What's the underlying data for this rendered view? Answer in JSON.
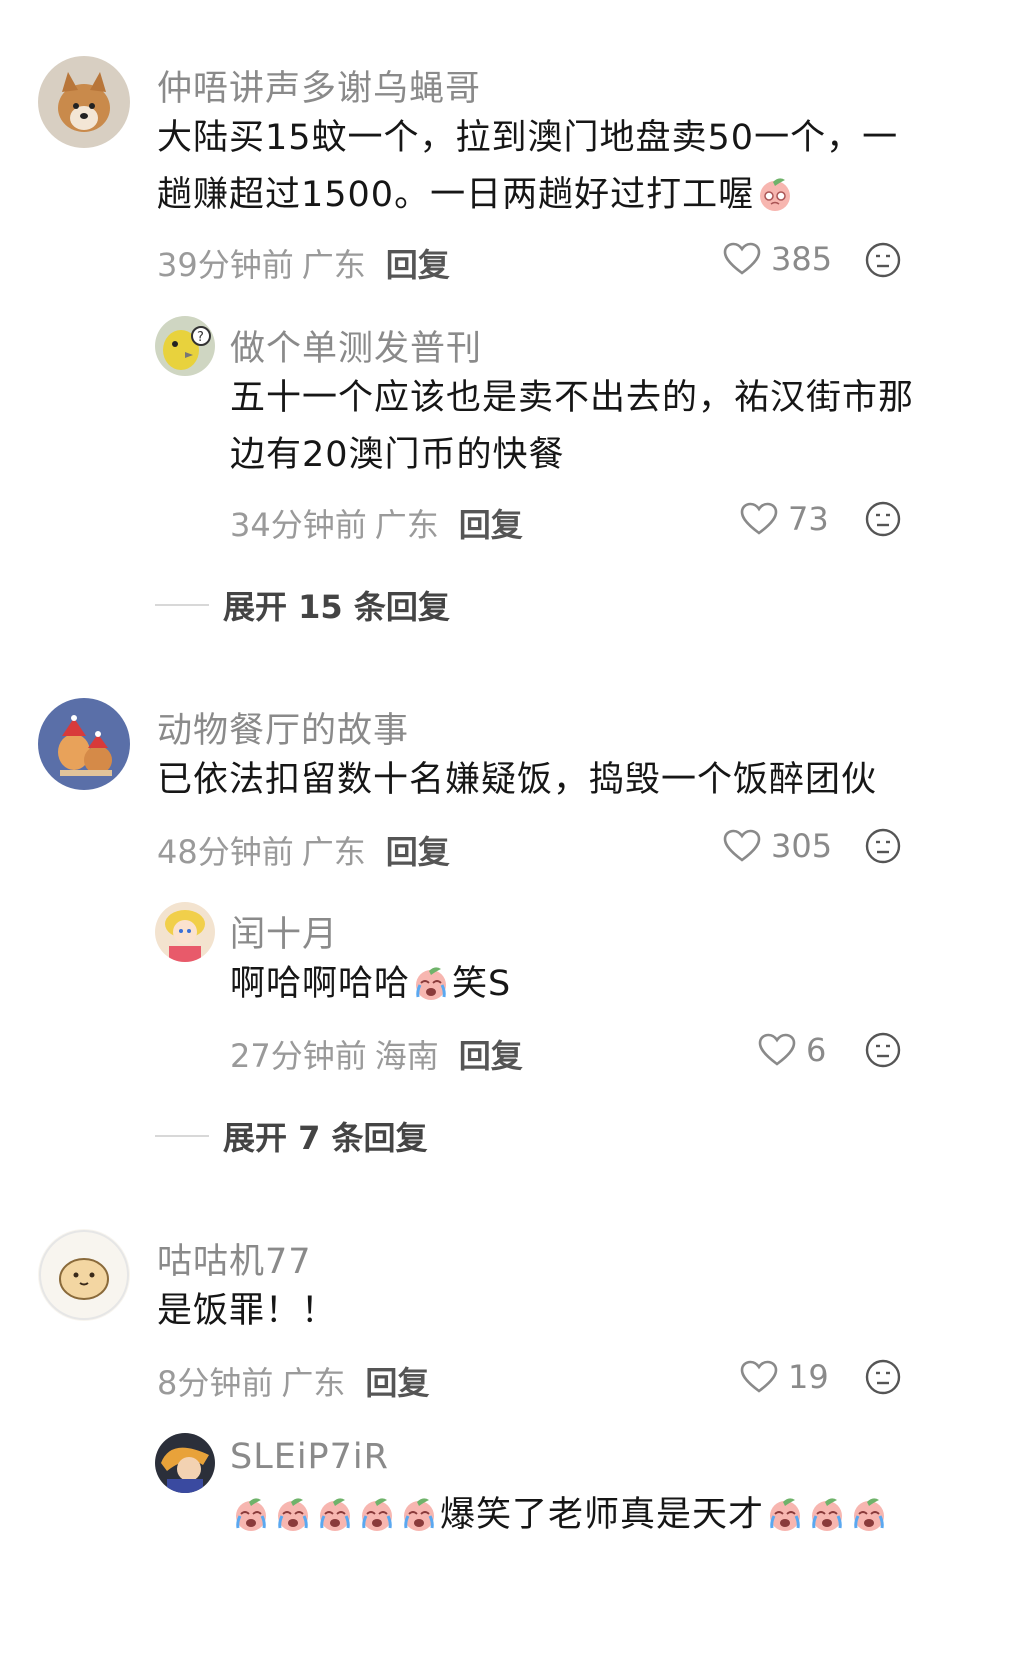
{
  "comments": [
    {
      "name": "仲唔讲声多谢乌蝇哥",
      "text": "大陆买15蚊一个，拉到澳门地盘卖50一个，一趟赚超过1500。一日两趟好过打工喔",
      "time": "39分钟前",
      "location": "广东",
      "reply_label": "回复",
      "likes": "385",
      "avatar": "shiba-dog-photo"
    },
    {
      "name": "做个单测发普刊",
      "text": "五十一个应该也是卖不出去的，祐汉街市那边有20澳门币的快餐",
      "time": "34分钟前",
      "location": "广东",
      "reply_label": "回复",
      "likes": "73",
      "avatar": "yellow-bird-photo"
    },
    {
      "expand": "展开 15 条回复"
    },
    {
      "name": "动物餐厅的故事",
      "text": "已依法扣留数十名嫌疑饭，捣毁一个饭醉团伙",
      "time": "48分钟前",
      "location": "广东",
      "reply_label": "回复",
      "likes": "305",
      "avatar": "cartoon-animals"
    },
    {
      "name": "闰十月",
      "text_a": "啊哈啊哈哈",
      "text_b": "笑S",
      "time": "27分钟前",
      "location": "海南",
      "reply_label": "回复",
      "likes": "6",
      "avatar": "anime-girl"
    },
    {
      "expand": "展开 7 条回复"
    },
    {
      "name": "咕咕机77",
      "text": "是饭罪！！",
      "time": "8分钟前",
      "location": "广东",
      "reply_label": "回复",
      "likes": "19",
      "avatar": "cartoon-bread"
    },
    {
      "name": "SLEiP7iR",
      "text": "爆笑了老师真是天才",
      "avatar": "anime-character"
    }
  ],
  "colors": {
    "name": "#8a8a8a",
    "text": "#161616",
    "meta": "#9a9a9a",
    "sticker": "#f4a3a3"
  },
  "icons": [
    "heart-icon",
    "emoji-reaction-icon",
    "peach-sticker-icon",
    "crying-laugh-sticker-icon"
  ]
}
